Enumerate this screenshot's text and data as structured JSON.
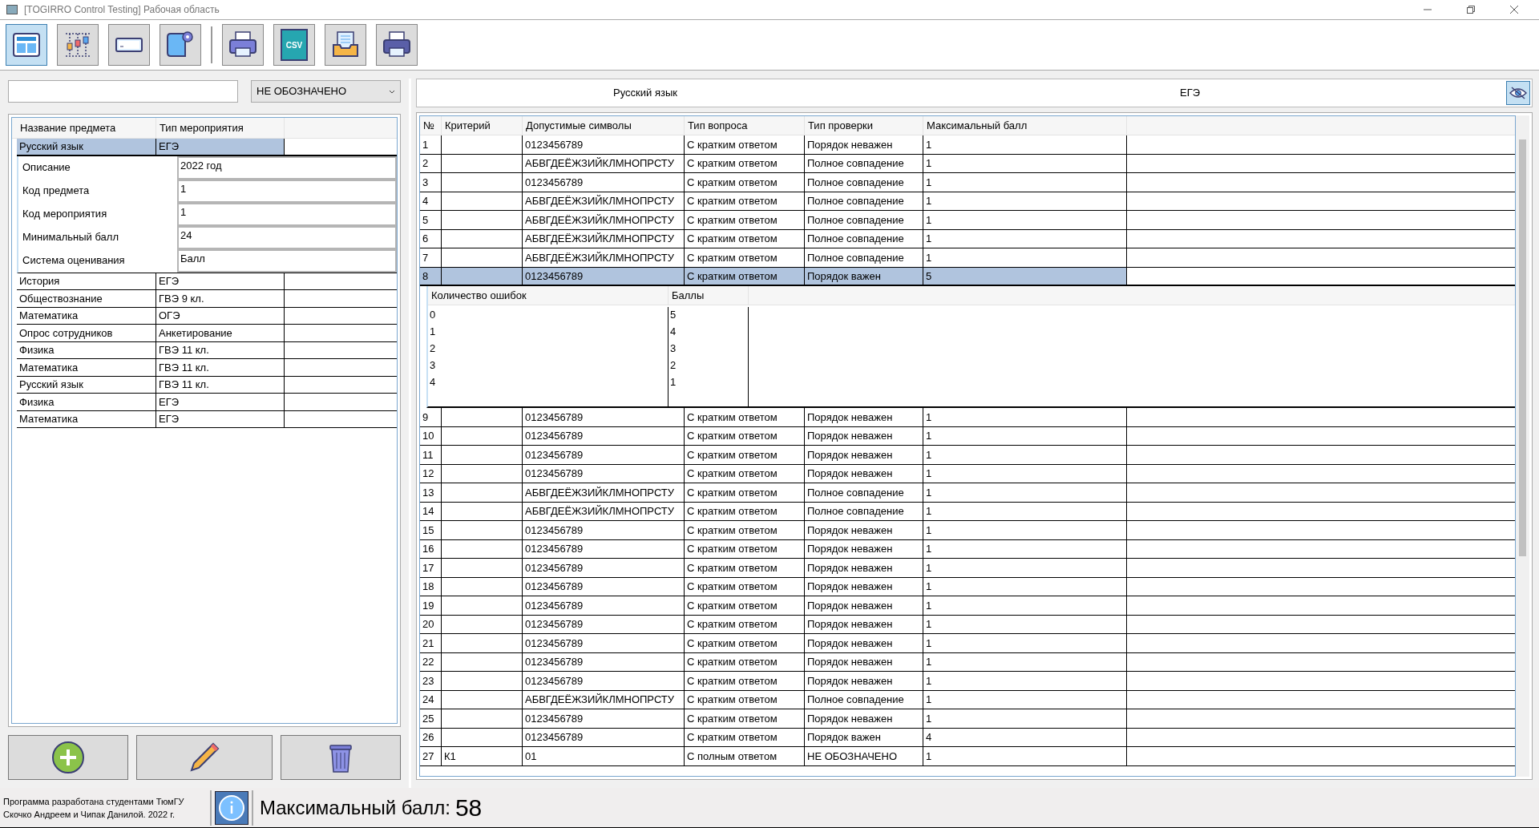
{
  "window": {
    "title": "[TOGIRRO Control Testing] Рабочая область"
  },
  "toolbar": [
    {
      "kind": "layout",
      "selected": true
    },
    {
      "kind": "chart",
      "selected": false
    },
    {
      "kind": "field",
      "selected": false
    },
    {
      "kind": "scroll",
      "selected": false
    },
    {
      "kind": "printer",
      "selected": false
    },
    {
      "kind": "csv",
      "selected": false,
      "text": "CSV"
    },
    {
      "kind": "inbox",
      "selected": false
    },
    {
      "kind": "printer2",
      "selected": false
    }
  ],
  "filter": {
    "dropdown": "НЕ ОБОЗНАЧЕНО"
  },
  "subjects": {
    "columns": [
      "Название предмета",
      "Тип мероприятия"
    ],
    "rows": [
      {
        "name": "Русский язык",
        "type": "ЕГЭ",
        "selected": true,
        "expanded": true,
        "details": [
          {
            "label": "Описание",
            "value": "2022 год"
          },
          {
            "label": "Код предмета",
            "value": "1"
          },
          {
            "label": "Код мероприятия",
            "value": "1"
          },
          {
            "label": "Минимальный балл",
            "value": "24"
          },
          {
            "label": "Система оценивания",
            "value": "Балл"
          }
        ]
      },
      {
        "name": "История",
        "type": "ЕГЭ",
        "selected": false,
        "expanded": false
      },
      {
        "name": "Обществознание",
        "type": "ГВЭ 9 кл.",
        "selected": false,
        "expanded": false
      },
      {
        "name": "Математика",
        "type": "ОГЭ",
        "selected": false,
        "expanded": false
      },
      {
        "name": "Опрос сотрудников",
        "type": "Анкетирование",
        "selected": false,
        "expanded": false
      },
      {
        "name": "Физика",
        "type": "ГВЭ 11 кл.",
        "selected": false,
        "expanded": false
      },
      {
        "name": "Математика",
        "type": "ГВЭ 11 кл.",
        "selected": false,
        "expanded": false
      },
      {
        "name": "Русский язык",
        "type": "ГВЭ 11 кл.",
        "selected": false,
        "expanded": false
      },
      {
        "name": "Физика",
        "type": "ЕГЭ",
        "selected": false,
        "expanded": false
      },
      {
        "name": "Математика",
        "type": "ЕГЭ",
        "selected": false,
        "expanded": false
      }
    ]
  },
  "actions": [
    {
      "kind": "add"
    },
    {
      "kind": "edit"
    },
    {
      "kind": "delete"
    }
  ],
  "header": {
    "subject": "Русский язык",
    "event": "ЕГЭ"
  },
  "criteria": {
    "columns": [
      "№",
      "Критерий",
      "Допустимые символы",
      "Тип вопроса",
      "Тип проверки",
      "Максимальный балл"
    ],
    "rows": [
      {
        "cells": [
          "1",
          "",
          "0123456789",
          "С кратким ответом",
          "Порядок неважен",
          "1"
        ],
        "selected": false,
        "expanded": false
      },
      {
        "cells": [
          "2",
          "",
          "АБВГДЕЁЖЗИЙКЛМНОПРСТУ",
          "С кратким ответом",
          "Полное совпадение",
          "1"
        ],
        "selected": false,
        "expanded": false
      },
      {
        "cells": [
          "3",
          "",
          "0123456789",
          "С кратким ответом",
          "Полное совпадение",
          "1"
        ],
        "selected": false,
        "expanded": false
      },
      {
        "cells": [
          "4",
          "",
          "АБВГДЕЁЖЗИЙКЛМНОПРСТУ",
          "С кратким ответом",
          "Полное совпадение",
          "1"
        ],
        "selected": false,
        "expanded": false
      },
      {
        "cells": [
          "5",
          "",
          "АБВГДЕЁЖЗИЙКЛМНОПРСТУ",
          "С кратким ответом",
          "Полное совпадение",
          "1"
        ],
        "selected": false,
        "expanded": false
      },
      {
        "cells": [
          "6",
          "",
          "АБВГДЕЁЖЗИЙКЛМНОПРСТУ",
          "С кратким ответом",
          "Полное совпадение",
          "1"
        ],
        "selected": false,
        "expanded": false
      },
      {
        "cells": [
          "7",
          "",
          "АБВГДЕЁЖЗИЙКЛМНОПРСТУ",
          "С кратким ответом",
          "Полное совпадение",
          "1"
        ],
        "selected": false,
        "expanded": false
      },
      {
        "cells": [
          "8",
          "",
          "0123456789",
          "С кратким ответом",
          "Порядок важен",
          "5"
        ],
        "selected": true,
        "expanded": true,
        "scores": {
          "columns": [
            "Количество ошибок",
            "Баллы"
          ],
          "rows": [
            [
              "0",
              "5"
            ],
            [
              "1",
              "4"
            ],
            [
              "2",
              "3"
            ],
            [
              "3",
              "2"
            ],
            [
              "4",
              "1"
            ]
          ]
        }
      },
      {
        "cells": [
          "9",
          "",
          "0123456789",
          "С кратким ответом",
          "Порядок неважен",
          "1"
        ],
        "selected": false,
        "expanded": false
      },
      {
        "cells": [
          "10",
          "",
          "0123456789",
          "С кратким ответом",
          "Порядок неважен",
          "1"
        ],
        "selected": false,
        "expanded": false
      },
      {
        "cells": [
          "11",
          "",
          "0123456789",
          "С кратким ответом",
          "Порядок неважен",
          "1"
        ],
        "selected": false,
        "expanded": false
      },
      {
        "cells": [
          "12",
          "",
          "0123456789",
          "С кратким ответом",
          "Порядок неважен",
          "1"
        ],
        "selected": false,
        "expanded": false
      },
      {
        "cells": [
          "13",
          "",
          "АБВГДЕЁЖЗИЙКЛМНОПРСТУ",
          "С кратким ответом",
          "Полное совпадение",
          "1"
        ],
        "selected": false,
        "expanded": false
      },
      {
        "cells": [
          "14",
          "",
          "АБВГДЕЁЖЗИЙКЛМНОПРСТУ",
          "С кратким ответом",
          "Полное совпадение",
          "1"
        ],
        "selected": false,
        "expanded": false
      },
      {
        "cells": [
          "15",
          "",
          "0123456789",
          "С кратким ответом",
          "Порядок неважен",
          "1"
        ],
        "selected": false,
        "expanded": false
      },
      {
        "cells": [
          "16",
          "",
          "0123456789",
          "С кратким ответом",
          "Порядок неважен",
          "1"
        ],
        "selected": false,
        "expanded": false
      },
      {
        "cells": [
          "17",
          "",
          "0123456789",
          "С кратким ответом",
          "Порядок неважен",
          "1"
        ],
        "selected": false,
        "expanded": false
      },
      {
        "cells": [
          "18",
          "",
          "0123456789",
          "С кратким ответом",
          "Порядок неважен",
          "1"
        ],
        "selected": false,
        "expanded": false
      },
      {
        "cells": [
          "19",
          "",
          "0123456789",
          "С кратким ответом",
          "Порядок неважен",
          "1"
        ],
        "selected": false,
        "expanded": false
      },
      {
        "cells": [
          "20",
          "",
          "0123456789",
          "С кратким ответом",
          "Порядок неважен",
          "1"
        ],
        "selected": false,
        "expanded": false
      },
      {
        "cells": [
          "21",
          "",
          "0123456789",
          "С кратким ответом",
          "Порядок неважен",
          "1"
        ],
        "selected": false,
        "expanded": false
      },
      {
        "cells": [
          "22",
          "",
          "0123456789",
          "С кратким ответом",
          "Порядок неважен",
          "1"
        ],
        "selected": false,
        "expanded": false
      },
      {
        "cells": [
          "23",
          "",
          "0123456789",
          "С кратким ответом",
          "Порядок неважен",
          "1"
        ],
        "selected": false,
        "expanded": false
      },
      {
        "cells": [
          "24",
          "",
          "АБВГДЕЁЖЗИЙКЛМНОПРСТУ",
          "С кратким ответом",
          "Полное совпадение",
          "1"
        ],
        "selected": false,
        "expanded": false
      },
      {
        "cells": [
          "25",
          "",
          "0123456789",
          "С кратким ответом",
          "Порядок неважен",
          "1"
        ],
        "selected": false,
        "expanded": false
      },
      {
        "cells": [
          "26",
          "",
          "0123456789",
          "С кратким ответом",
          "Порядок важен",
          "4"
        ],
        "selected": false,
        "expanded": false
      },
      {
        "cells": [
          "27",
          "К1",
          "01",
          "С полным ответом",
          "НЕ ОБОЗНАЧЕНО",
          "1"
        ],
        "selected": false,
        "expanded": false
      }
    ]
  },
  "status": {
    "credits": [
      "Программа разработана студентами ТюмГУ",
      "Скочко Андреем и Чипак Данилой. 2022 г."
    ],
    "max_label": "Максимальный балл:",
    "max_value": "58"
  }
}
